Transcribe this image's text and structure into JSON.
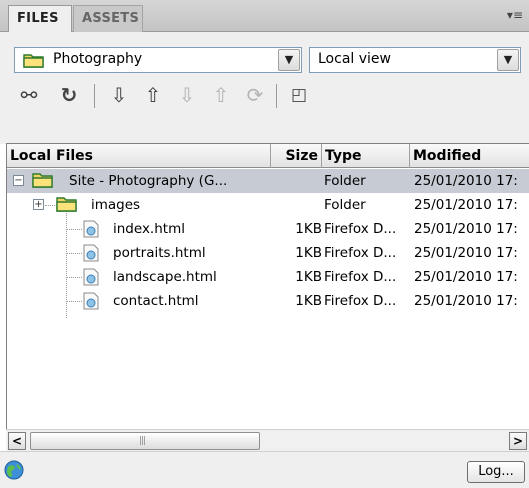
{
  "tabs": [
    {
      "label": "FILES",
      "active": true
    },
    {
      "label": "ASSETS",
      "active": false
    }
  ],
  "panel_menu_icon": "panel-options-icon",
  "site_select": {
    "value": "Photography",
    "icon": "folder-icon"
  },
  "view_select": {
    "value": "Local view"
  },
  "toolbar": {
    "icons": [
      {
        "name": "connect-icon",
        "glyph": "⚯",
        "enabled": true
      },
      {
        "name": "refresh-icon",
        "glyph": "↻",
        "enabled": true
      },
      {
        "name": "get-files-icon",
        "glyph": "⇩",
        "enabled": true
      },
      {
        "name": "put-files-icon",
        "glyph": "⇧",
        "enabled": true
      },
      {
        "name": "check-out-icon",
        "glyph": "⇩",
        "enabled": false
      },
      {
        "name": "check-in-icon",
        "glyph": "⇧",
        "enabled": false
      },
      {
        "name": "synchronize-icon",
        "glyph": "⟳",
        "enabled": false
      },
      {
        "name": "expand-icon",
        "glyph": "◰",
        "enabled": true
      }
    ]
  },
  "columns": {
    "name": "Local Files",
    "size": "Size",
    "type": "Type",
    "modified": "Modified"
  },
  "rows": [
    {
      "name": "Site - Photography (G...",
      "size": "",
      "type": "Folder",
      "modified": "25/01/2010 17:",
      "kind": "site",
      "selected": true
    },
    {
      "name": "images",
      "size": "",
      "type": "Folder",
      "modified": "25/01/2010 17:",
      "kind": "folder",
      "selected": false
    },
    {
      "name": "index.html",
      "size": "1KB",
      "type": "Firefox D...",
      "modified": "25/01/2010 17:",
      "kind": "file",
      "selected": false
    },
    {
      "name": "portraits.html",
      "size": "1KB",
      "type": "Firefox D...",
      "modified": "25/01/2010 17:",
      "kind": "file",
      "selected": false
    },
    {
      "name": "landscape.html",
      "size": "1KB",
      "type": "Firefox D...",
      "modified": "25/01/2010 17:",
      "kind": "file",
      "selected": false
    },
    {
      "name": "contact.html",
      "size": "1KB",
      "type": "Firefox D...",
      "modified": "25/01/2010 17:",
      "kind": "file",
      "selected": false
    }
  ],
  "status": {
    "log_button": "Log..."
  }
}
